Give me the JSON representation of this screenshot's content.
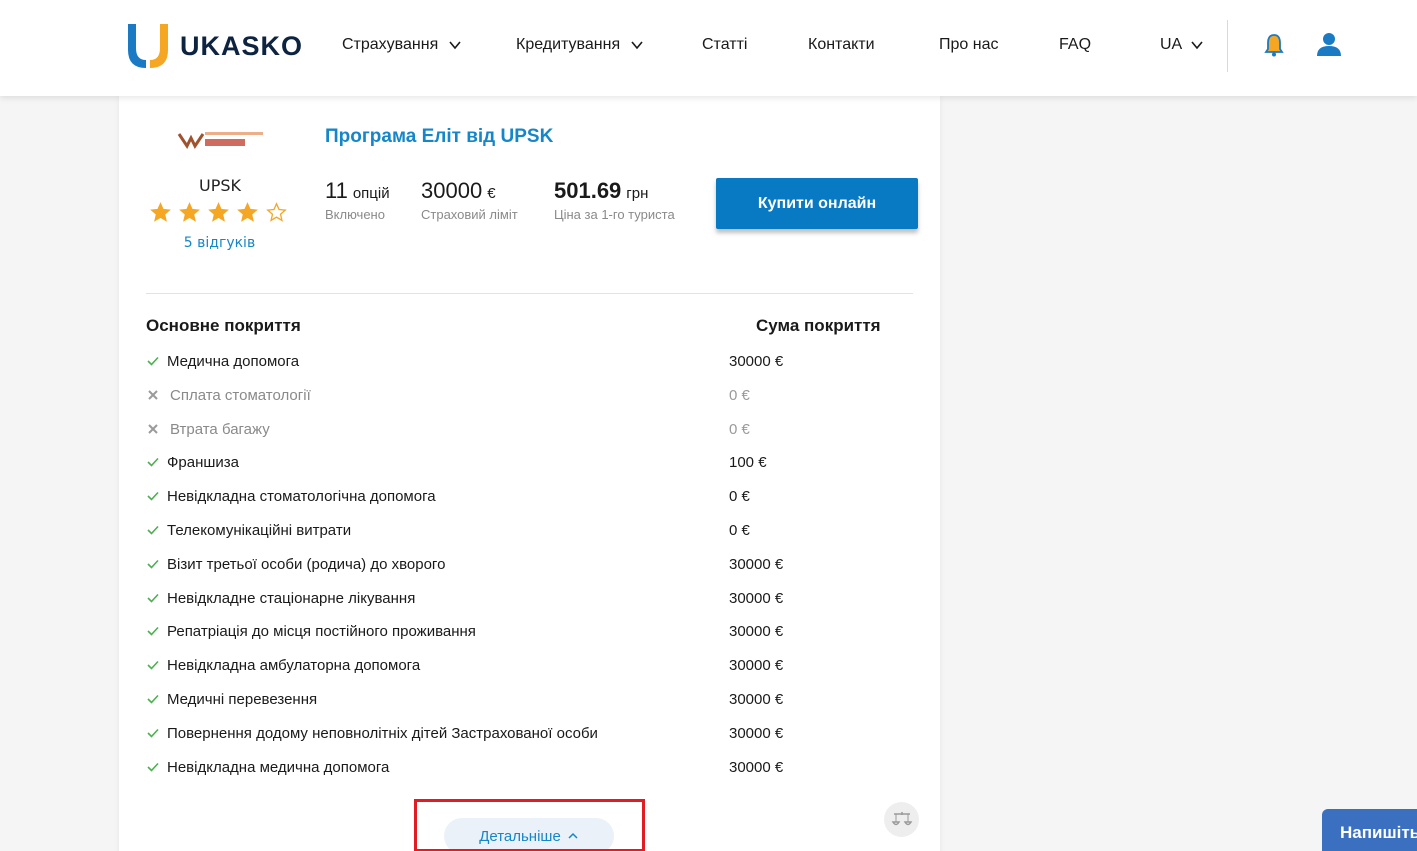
{
  "brand": {
    "name": "UKASKO"
  },
  "nav": {
    "items": [
      {
        "label": "Страхування",
        "has_dropdown": true
      },
      {
        "label": "Кредитування",
        "has_dropdown": true
      },
      {
        "label": "Статті",
        "has_dropdown": false
      },
      {
        "label": "Контакти",
        "has_dropdown": false
      },
      {
        "label": "Про нас",
        "has_dropdown": false
      },
      {
        "label": "FAQ",
        "has_dropdown": false
      }
    ],
    "language": "UA"
  },
  "offer": {
    "provider_name": "UPSK",
    "program_title": "Програма Еліт від UPSK",
    "rating": 4,
    "rating_max": 5,
    "reviews_label": "5 відгуків",
    "stats": [
      {
        "value": "11",
        "unit": "опцій",
        "label": "Включено"
      },
      {
        "value": "30000",
        "unit": "€",
        "label": "Страховий ліміт"
      },
      {
        "value": "501.69",
        "unit": "грн",
        "label": "Ціна за 1-го туриста"
      }
    ],
    "buy_label": "Купити онлайн"
  },
  "coverage": {
    "header_name": "Основне покриття",
    "header_amount": "Сума покриття",
    "rows": [
      {
        "name": "Медична допомога",
        "amount": "30000 €",
        "included": true
      },
      {
        "name": "Сплата стоматології",
        "amount": "0 €",
        "included": false
      },
      {
        "name": "Втрата багажу",
        "amount": "0 €",
        "included": false
      },
      {
        "name": "Франшиза",
        "amount": "100 €",
        "included": true
      },
      {
        "name": "Невідкладна стоматологічна допомога",
        "amount": "0 €",
        "included": true
      },
      {
        "name": "Телекомунікаційні витрати",
        "amount": "0 €",
        "included": true
      },
      {
        "name": "Візит третьої особи (родича) до хворого",
        "amount": "30000 €",
        "included": true
      },
      {
        "name": "Невідкладне стаціонарне лікування",
        "amount": "30000 €",
        "included": true
      },
      {
        "name": "Репатріація до місця постійного проживання",
        "amount": "30000 €",
        "included": true
      },
      {
        "name": "Невідкладна амбулаторна допомога",
        "amount": "30000 €",
        "included": true
      },
      {
        "name": "Медичні перевезення",
        "amount": "30000 €",
        "included": true
      },
      {
        "name": "Повернення додому неповнолітніх дітей Застрахованої особи",
        "amount": "30000 €",
        "included": true
      },
      {
        "name": "Невідкладна медична допомога",
        "amount": "30000 €",
        "included": true
      }
    ]
  },
  "details_label": "Детальніше",
  "chat_label": "Напишіть",
  "colors": {
    "accent": "#0879c3",
    "link": "#1586c9",
    "star": "#f5a623",
    "check": "#4caf50",
    "highlight": "#e31b23"
  },
  "icons": [
    "chevron-down-icon",
    "bell-icon",
    "user-icon",
    "star-icon",
    "check-icon",
    "cross-icon",
    "chevron-up-icon",
    "scales-icon"
  ]
}
